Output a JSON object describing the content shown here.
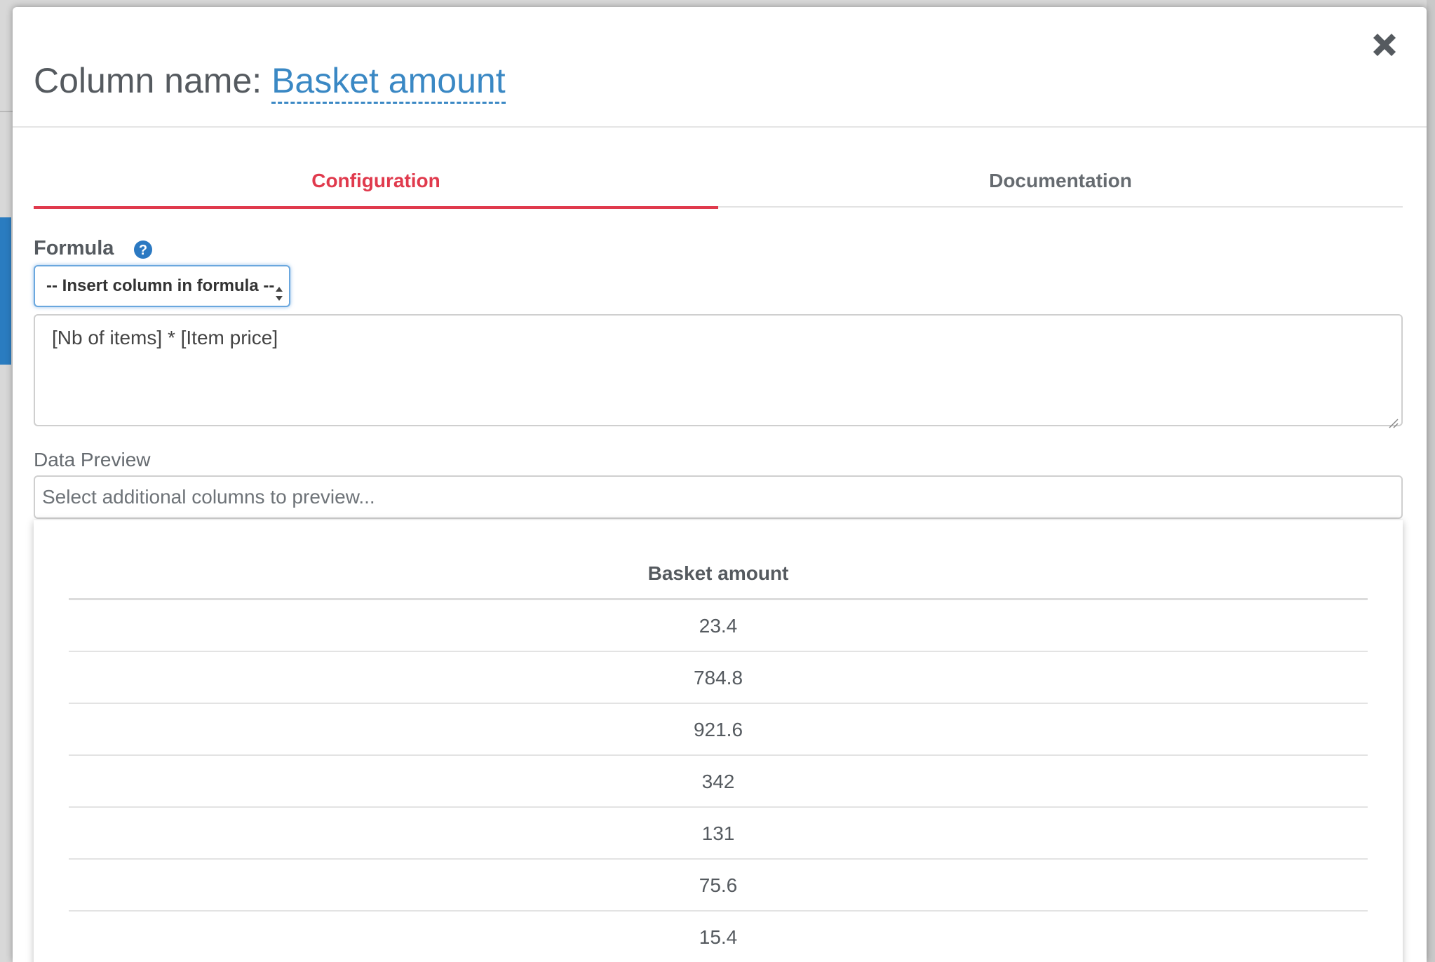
{
  "modal": {
    "title_prefix": "Column name:",
    "column_name": "Basket amount",
    "close_icon": "close-icon"
  },
  "tabs": [
    {
      "label": "Configuration",
      "active": true
    },
    {
      "label": "Documentation",
      "active": false
    }
  ],
  "formula": {
    "label": "Formula",
    "help_icon": "question-circle-icon",
    "insert_select_value": "-- Insert column in formula --",
    "expression": "[Nb of items] * [Item price]"
  },
  "data_preview": {
    "label": "Data Preview",
    "columns_placeholder": "Select additional columns to preview...",
    "table": {
      "header": "Basket amount",
      "rows": [
        "23.4",
        "784.8",
        "921.6",
        "342",
        "131",
        "75.6",
        "15.4"
      ]
    }
  },
  "colors": {
    "accent_red": "#e03a4d",
    "link_blue": "#3a88c4",
    "help_blue": "#2b79c2"
  }
}
